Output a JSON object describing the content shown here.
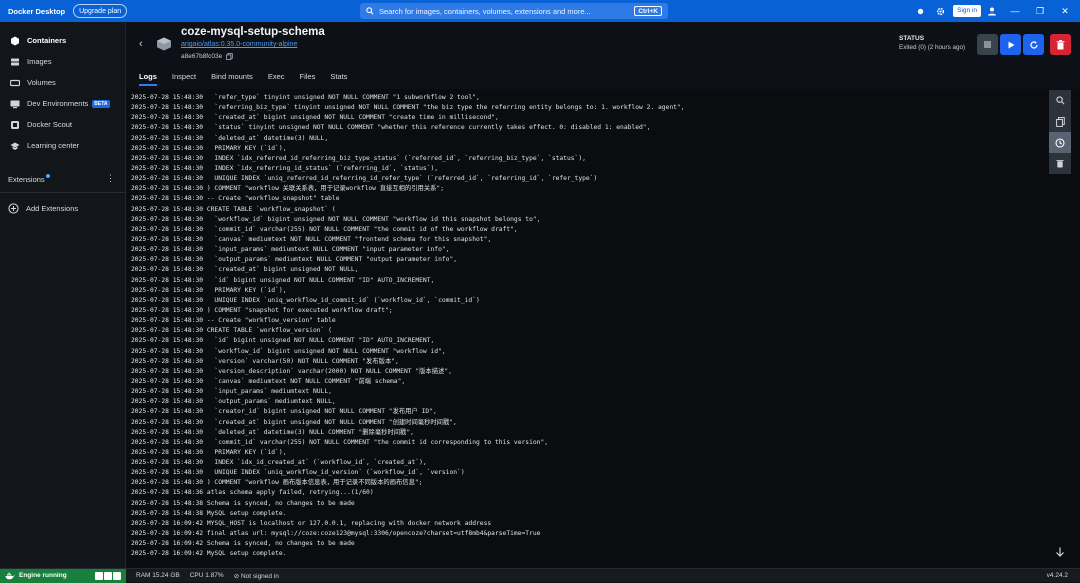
{
  "titlebar": {
    "app_title": "Docker Desktop",
    "upgrade_label": "Upgrade plan",
    "search_placeholder": "Search for images, containers, volumes, extensions and more...",
    "search_shortcut": "Ctrl+K",
    "signin_label": "Sign in",
    "accent_color": "#0961d6"
  },
  "sidebar": {
    "items": [
      {
        "label": "Containers",
        "icon": "containers-icon",
        "active": true
      },
      {
        "label": "Images",
        "icon": "images-icon"
      },
      {
        "label": "Volumes",
        "icon": "volumes-icon"
      },
      {
        "label": "Dev Environments",
        "icon": "dev-environments-icon",
        "badge": "BETA"
      },
      {
        "label": "Docker Scout",
        "icon": "docker-scout-icon"
      },
      {
        "label": "Learning center",
        "icon": "learning-center-icon"
      }
    ],
    "extensions_label": "Extensions",
    "add_extensions_label": "Add Extensions"
  },
  "container": {
    "name": "coze-mysql-setup-schema",
    "image": "arigaio/atlas:0.35.0-community-alpine",
    "id": "a8e67b8fc03e",
    "status_label": "STATUS",
    "status_value": "Exited (0) (2 hours ago)"
  },
  "tabs": [
    "Logs",
    "Inspect",
    "Bind mounts",
    "Exec",
    "Files",
    "Stats"
  ],
  "logs": [
    {
      "ts": "2025-07-28 15:48:30",
      "msg": "  `refer_type` tinyint unsigned NOT NULL COMMENT \"1 subworkflow 2 tool\","
    },
    {
      "ts": "2025-07-28 15:48:30",
      "msg": "  `referring_biz_type` tinyint unsigned NOT NULL COMMENT \"the biz type the referring entity belongs to: 1. workflow 2. agent\","
    },
    {
      "ts": "2025-07-28 15:48:30",
      "msg": "  `created_at` bigint unsigned NOT NULL COMMENT \"create time in millisecond\","
    },
    {
      "ts": "2025-07-28 15:48:30",
      "msg": "  `status` tinyint unsigned NOT NULL COMMENT \"whether this reference currently takes effect. 0: disabled 1: enabled\","
    },
    {
      "ts": "2025-07-28 15:48:30",
      "msg": "  `deleted_at` datetime(3) NULL,"
    },
    {
      "ts": "2025-07-28 15:48:30",
      "msg": "  PRIMARY KEY (`id`),"
    },
    {
      "ts": "2025-07-28 15:48:30",
      "msg": "  INDEX `idx_referred_id_referring_biz_type_status` (`referred_id`, `referring_biz_type`, `status`),"
    },
    {
      "ts": "2025-07-28 15:48:30",
      "msg": "  INDEX `idx_referring_id_status` (`referring_id`, `status`),"
    },
    {
      "ts": "2025-07-28 15:48:30",
      "msg": "  UNIQUE INDEX `uniq_referred_id_referring_id_refer_type` (`referred_id`, `referring_id`, `refer_type`)"
    },
    {
      "ts": "2025-07-28 15:48:30",
      "msg": ") COMMENT \"workflow 关联关系表，用于记录workflow 直接互相的引用关系\";"
    },
    {
      "ts": "2025-07-28 15:48:30",
      "msg": "-- Create \"workflow_snapshot\" table"
    },
    {
      "ts": "2025-07-28 15:48:30",
      "msg": "CREATE TABLE `workflow_snapshot` ("
    },
    {
      "ts": "2025-07-28 15:48:30",
      "msg": "  `workflow_id` bigint unsigned NOT NULL COMMENT \"workflow id this snapshot belongs to\","
    },
    {
      "ts": "2025-07-28 15:48:30",
      "msg": "  `commit_id` varchar(255) NOT NULL COMMENT \"the commit id of the workflow draft\","
    },
    {
      "ts": "2025-07-28 15:48:30",
      "msg": "  `canvas` mediumtext NOT NULL COMMENT \"frontend schema for this snapshot\","
    },
    {
      "ts": "2025-07-28 15:48:30",
      "msg": "  `input_params` mediumtext NULL COMMENT \"input parameter info\","
    },
    {
      "ts": "2025-07-28 15:48:30",
      "msg": "  `output_params` mediumtext NULL COMMENT \"output parameter info\","
    },
    {
      "ts": "2025-07-28 15:48:30",
      "msg": "  `created_at` bigint unsigned NOT NULL,"
    },
    {
      "ts": "2025-07-28 15:48:30",
      "msg": "  `id` bigint unsigned NOT NULL COMMENT \"ID\" AUTO_INCREMENT,"
    },
    {
      "ts": "2025-07-28 15:48:30",
      "msg": "  PRIMARY KEY (`id`),"
    },
    {
      "ts": "2025-07-28 15:48:30",
      "msg": "  UNIQUE INDEX `uniq_workflow_id_commit_id` (`workflow_id`, `commit_id`)"
    },
    {
      "ts": "2025-07-28 15:48:30",
      "msg": ") COMMENT \"snapshot for executed workflow draft\";"
    },
    {
      "ts": "2025-07-28 15:48:30",
      "msg": "-- Create \"workflow_version\" table"
    },
    {
      "ts": "2025-07-28 15:48:30",
      "msg": "CREATE TABLE `workflow_version` ("
    },
    {
      "ts": "2025-07-28 15:48:30",
      "msg": "  `id` bigint unsigned NOT NULL COMMENT \"ID\" AUTO_INCREMENT,"
    },
    {
      "ts": "2025-07-28 15:48:30",
      "msg": "  `workflow_id` bigint unsigned NOT NULL COMMENT \"workflow id\","
    },
    {
      "ts": "2025-07-28 15:48:30",
      "msg": "  `version` varchar(50) NOT NULL COMMENT \"发布版本\","
    },
    {
      "ts": "2025-07-28 15:48:30",
      "msg": "  `version_description` varchar(2000) NOT NULL COMMENT \"版本描述\","
    },
    {
      "ts": "2025-07-28 15:48:30",
      "msg": "  `canvas` mediumtext NOT NULL COMMENT \"前端 schema\","
    },
    {
      "ts": "2025-07-28 15:48:30",
      "msg": "  `input_params` mediumtext NULL,"
    },
    {
      "ts": "2025-07-28 15:48:30",
      "msg": "  `output_params` mediumtext NULL,"
    },
    {
      "ts": "2025-07-28 15:48:30",
      "msg": "  `creator_id` bigint unsigned NOT NULL COMMENT \"发布用户 ID\","
    },
    {
      "ts": "2025-07-28 15:48:30",
      "msg": "  `created_at` bigint unsigned NOT NULL COMMENT \"创建时间毫秒时间戳\","
    },
    {
      "ts": "2025-07-28 15:48:30",
      "msg": "  `deleted_at` datetime(3) NULL COMMENT \"删除毫秒时间戳\","
    },
    {
      "ts": "2025-07-28 15:48:30",
      "msg": "  `commit_id` varchar(255) NOT NULL COMMENT \"the commit id corresponding to this version\","
    },
    {
      "ts": "2025-07-28 15:48:30",
      "msg": "  PRIMARY KEY (`id`),"
    },
    {
      "ts": "2025-07-28 15:48:30",
      "msg": "  INDEX `idx_id_created_at` (`workflow_id`, `created_at`),"
    },
    {
      "ts": "2025-07-28 15:48:30",
      "msg": "  UNIQUE INDEX `uniq_workflow_id_version` (`workflow_id`, `version`)"
    },
    {
      "ts": "2025-07-28 15:48:30",
      "msg": ") COMMENT \"workflow 画布版本信息表，用于记录不同版本的画布信息\";"
    },
    {
      "ts": "2025-07-28 15:48:36",
      "msg": "atlas schema apply failed, retrying...(1/60)"
    },
    {
      "ts": "2025-07-28 15:48:38",
      "msg": "Schema is synced, no changes to be made"
    },
    {
      "ts": "2025-07-28 15:48:38",
      "msg": "MySQL setup complete."
    },
    {
      "ts": "2025-07-28 16:09:42",
      "msg": "MYSQL_HOST is localhost or 127.0.0.1, replacing with docker network address"
    },
    {
      "ts": "2025-07-28 16:09:42",
      "msg": "final atlas url: mysql://coze:coze123@mysql:3306/opencoze?charset=utf8mb4&parseTime=True"
    },
    {
      "ts": "2025-07-28 16:09:42",
      "msg": "Schema is synced, no changes to be made"
    },
    {
      "ts": "2025-07-28 16:09:42",
      "msg": "MySQL setup complete."
    }
  ],
  "statusbar": {
    "engine": "Engine running",
    "ram": "RAM 15.24 GB",
    "cpu": "CPU 1.87%",
    "signed": "Not signed in",
    "version": "v4.24.2"
  }
}
